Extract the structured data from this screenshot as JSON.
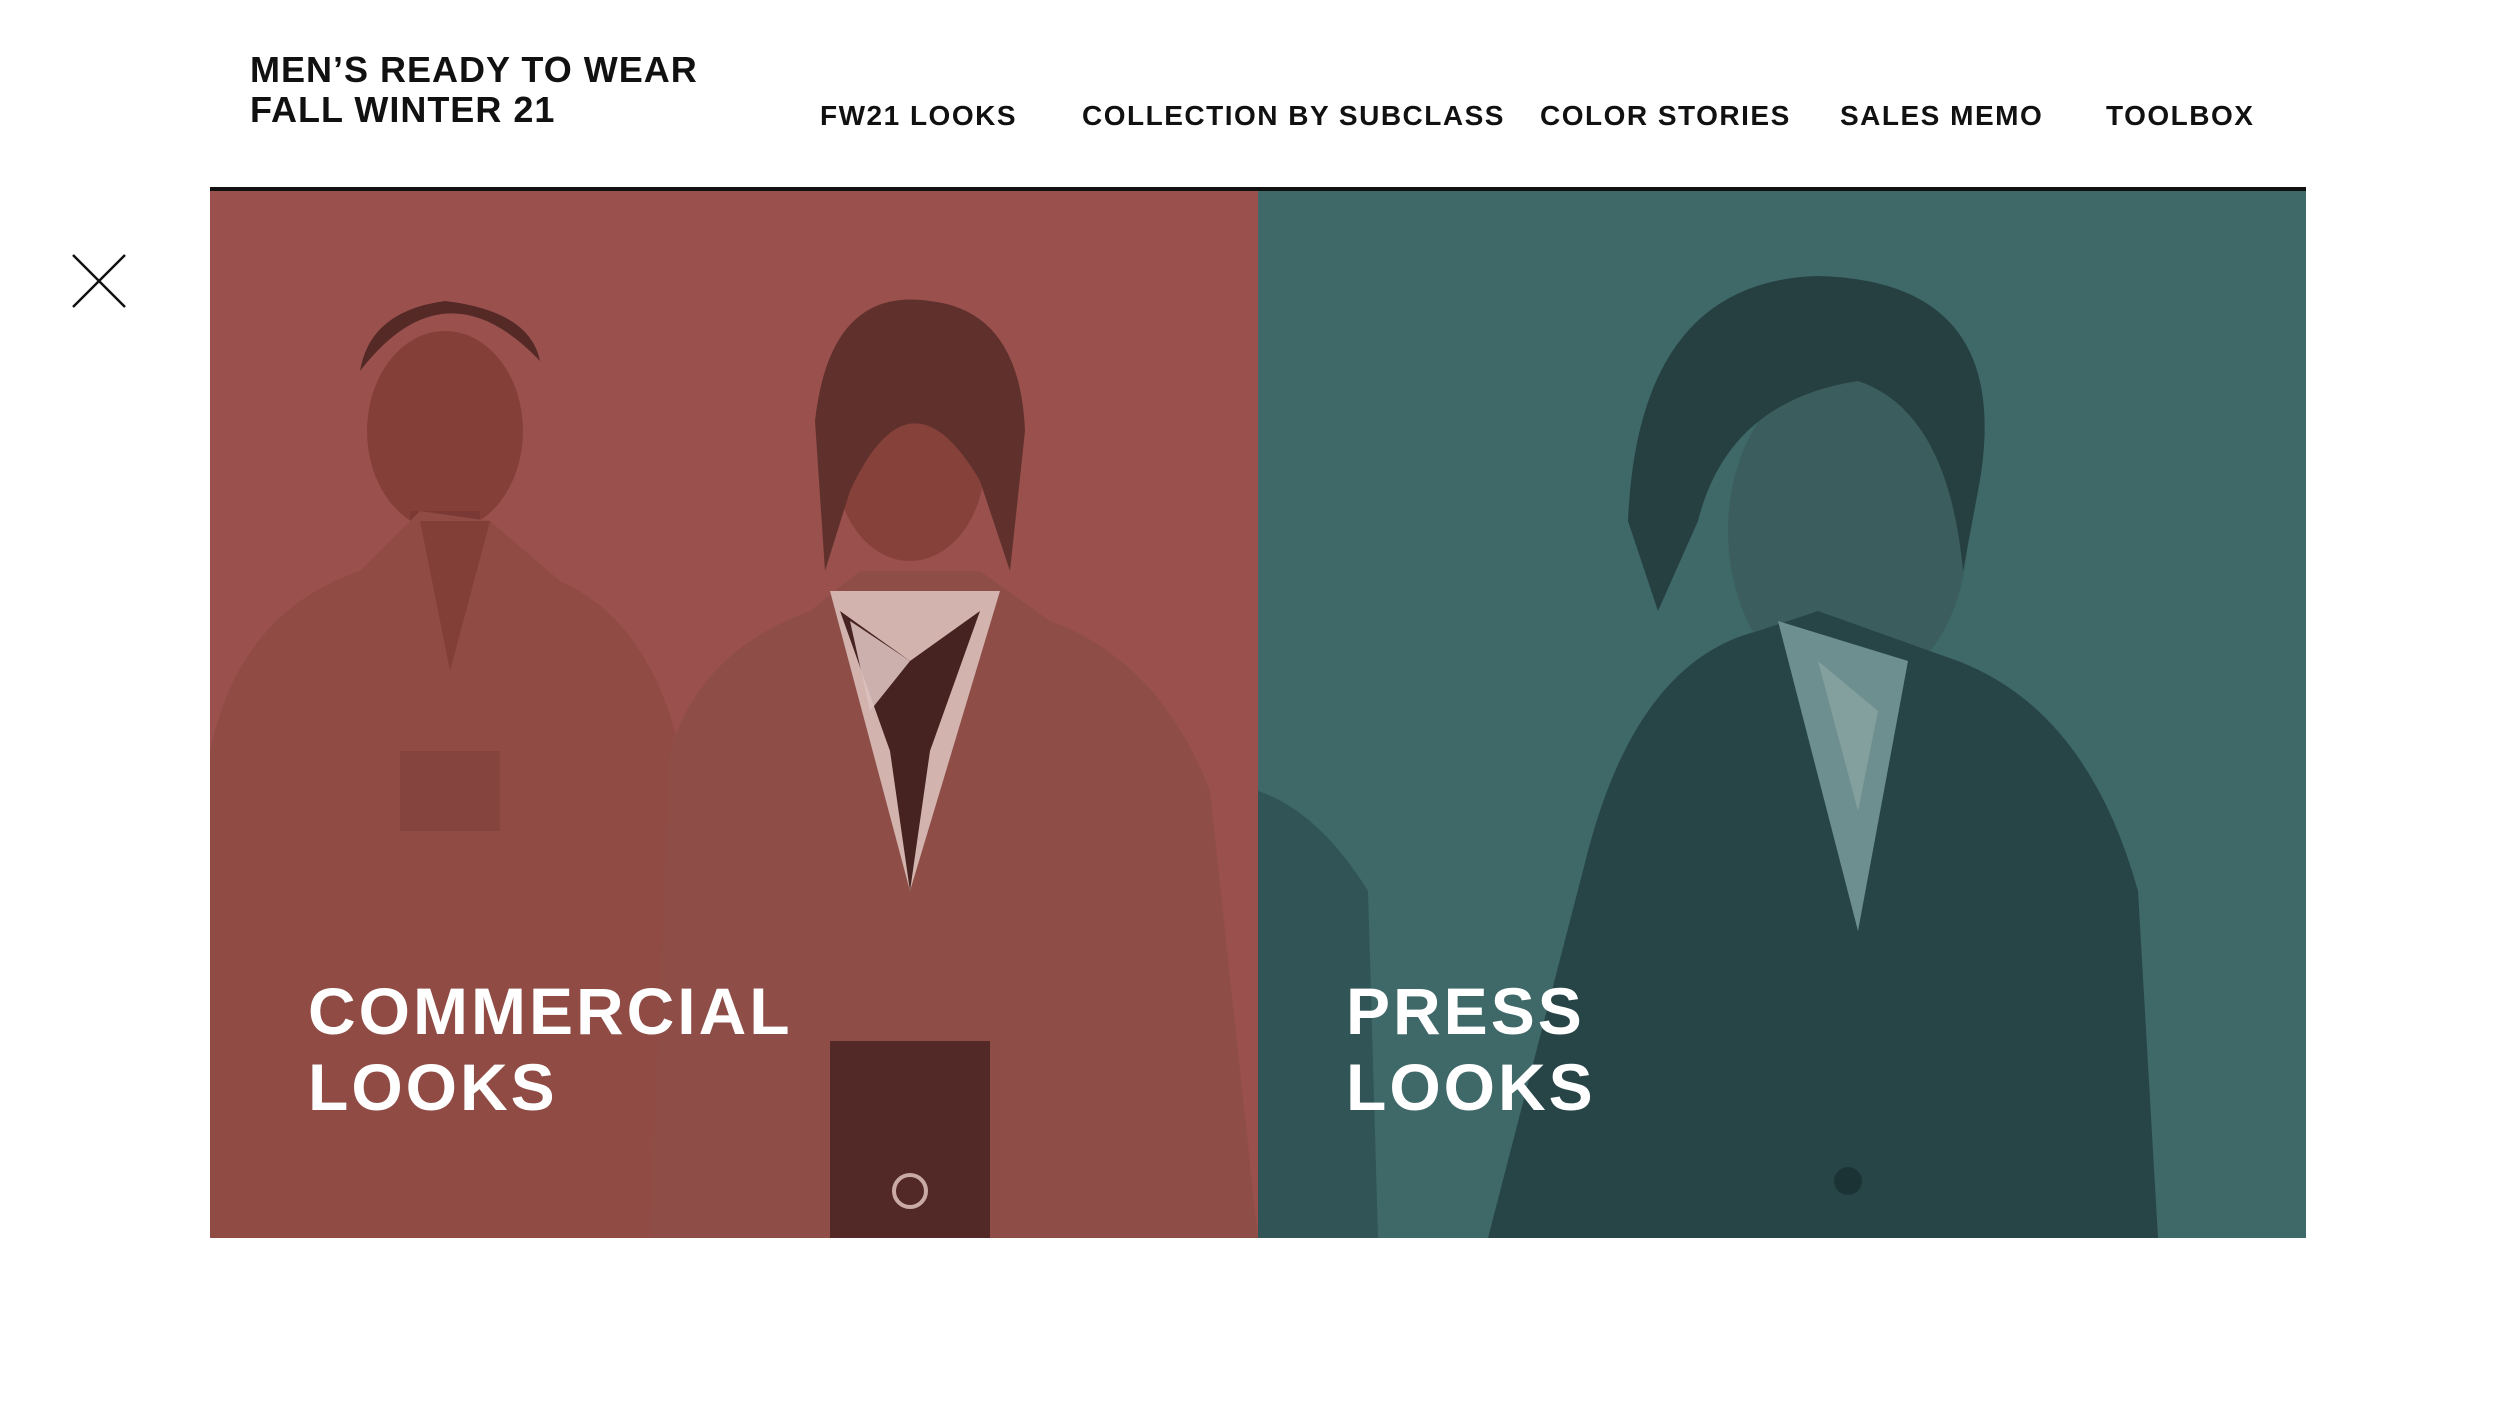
{
  "header": {
    "brand_line1": "MEN’S READY TO WEAR",
    "brand_line2": "FALL WINTER 21"
  },
  "nav": {
    "items": [
      {
        "label": "FW21 LOOKS"
      },
      {
        "label": "COLLECTION BY SUBCLASS"
      },
      {
        "label": "COLOR STORIES"
      },
      {
        "label": "SALES MEMO"
      },
      {
        "label": "TOOLBOX"
      }
    ]
  },
  "close": {
    "icon": "close-icon"
  },
  "panels": [
    {
      "title_line1": "COMMERCIAL",
      "title_line2": "LOOKS",
      "tint": "#9a4f4d"
    },
    {
      "title_line1": "PRESS",
      "title_line2": "LOOKS",
      "tint": "#3f6868"
    }
  ]
}
